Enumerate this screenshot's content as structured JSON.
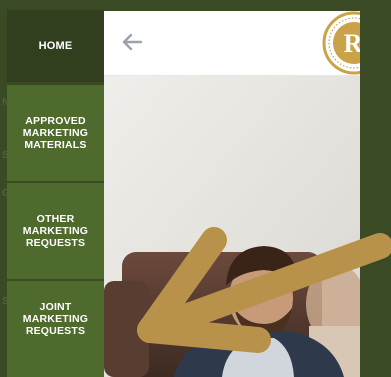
{
  "sidebar": {
    "items": [
      {
        "label": "HOME"
      },
      {
        "label": "APPROVED MARKETING MATERIALS"
      },
      {
        "label": "OTHER MARKETING REQUESTS"
      },
      {
        "label": "JOINT MARKETING REQUESTS"
      }
    ],
    "ghost_fragments": [
      "NK",
      "S",
      "GE",
      "S"
    ]
  },
  "header": {
    "back_icon": "arrow-left-icon",
    "logo_letter": "R"
  },
  "annotation": {
    "arrow_icon": "pointer-arrow-icon",
    "arrow_color": "#b8924a"
  },
  "colors": {
    "sidebar_active": "#323f1f",
    "sidebar_item": "#4e6a2c",
    "background": "#3a4a24",
    "logo_gold": "#c9a24a"
  }
}
